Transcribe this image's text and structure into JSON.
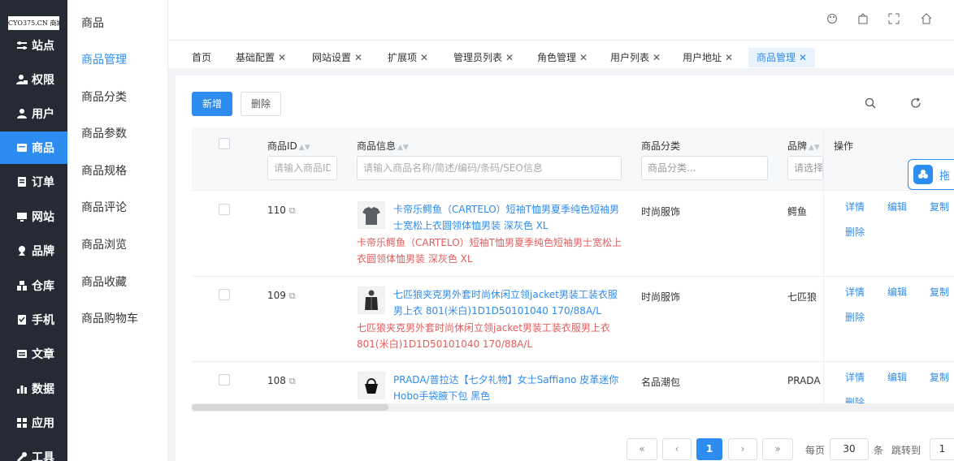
{
  "logo": {
    "text": "CYO375.CN 商城"
  },
  "sidebar": {
    "items": [
      {
        "label": "站点",
        "icon": "sliders-icon"
      },
      {
        "label": "权限",
        "icon": "user-lock-icon"
      },
      {
        "label": "用户",
        "icon": "user-icon"
      },
      {
        "label": "商品",
        "icon": "goods-icon",
        "active": true
      },
      {
        "label": "订单",
        "icon": "order-icon"
      },
      {
        "label": "网站",
        "icon": "monitor-icon"
      },
      {
        "label": "品牌",
        "icon": "brand-icon"
      },
      {
        "label": "仓库",
        "icon": "warehouse-icon"
      },
      {
        "label": "手机",
        "icon": "mobile-icon"
      },
      {
        "label": "文章",
        "icon": "article-icon"
      },
      {
        "label": "数据",
        "icon": "bar-chart-icon"
      },
      {
        "label": "应用",
        "icon": "apps-icon"
      },
      {
        "label": "工具",
        "icon": "wrench-icon"
      }
    ]
  },
  "submenu": {
    "title": "商品",
    "items": [
      "商品管理",
      "商品分类",
      "商品参数",
      "商品规格",
      "商品评论",
      "商品浏览",
      "商品收藏",
      "商品购物车"
    ]
  },
  "tabs": [
    {
      "label": "首页",
      "closable": false
    },
    {
      "label": "基础配置",
      "closable": true
    },
    {
      "label": "网站设置",
      "closable": true
    },
    {
      "label": "扩展项",
      "closable": true
    },
    {
      "label": "管理员列表",
      "closable": true
    },
    {
      "label": "角色管理",
      "closable": true
    },
    {
      "label": "用户列表",
      "closable": true
    },
    {
      "label": "用户地址",
      "closable": true
    },
    {
      "label": "商品管理",
      "closable": true,
      "active": true
    }
  ],
  "toolbar": {
    "add_label": "新增",
    "delete_label": "删除"
  },
  "table": {
    "columns": {
      "id": "商品ID",
      "info": "商品信息",
      "category": "商品分类",
      "brand": "品牌",
      "actions": "操作"
    },
    "filters": {
      "id_placeholder": "请输入商品ID",
      "info_placeholder": "请输入商品名称/简述/编码/条码/SEO信息",
      "category_placeholder": "商品分类...",
      "brand_placeholder": "请选择"
    },
    "rows": [
      {
        "id": "110",
        "title": "卡帝乐鳄鱼（CARTELO）短袖T恤男夏季纯色短袖男士宽松上衣圆领体恤男装 深灰色 XL",
        "subtitle": "卡帝乐鳄鱼（CARTELO）短袖T恤男夏季纯色短袖男士宽松上衣圆领体恤男装 深灰色 XL",
        "category": "时尚服饰",
        "brand": "鳄鱼"
      },
      {
        "id": "109",
        "title": "七匹狼夹克男外套时尚休闲立领jacket男装工装衣服男上衣 801(米白)1D1D50101040 170/88A/L",
        "subtitle": "七匹狼夹克男外套时尚休闲立领jacket男装工装衣服男上衣 801(米白)1D1D50101040 170/88A/L",
        "category": "时尚服饰",
        "brand": "七匹狼"
      },
      {
        "id": "108",
        "title": "PRADA/普拉达【七夕礼物】女士Saffiano 皮革迷你Hobo手袋腋下包 黑色",
        "subtitle": "",
        "category": "名品潮包",
        "brand": "PRADA"
      }
    ],
    "actions": {
      "detail": "详情",
      "edit": "编辑",
      "copy": "复制",
      "delete": "删除"
    }
  },
  "float_button": {
    "label": "拖"
  },
  "pagination": {
    "first": "«",
    "prev": "‹",
    "current": "1",
    "next": "›",
    "last": "»",
    "per_page_label": "每页",
    "per_page_value": "30",
    "unit": "条",
    "jump_label": "跳转到",
    "jump_value": "1"
  },
  "colors": {
    "sidebar_bg": "#252a34",
    "accent": "#2d8cf0",
    "subtitle_red": "#e35d5d"
  }
}
